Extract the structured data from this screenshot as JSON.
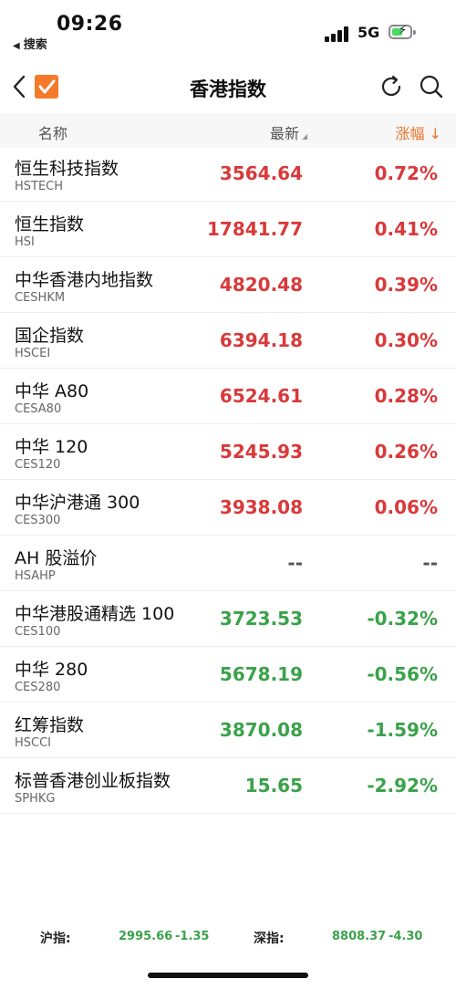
{
  "status_bar": {
    "time": "09:26",
    "back_app": "搜索",
    "network": "5G"
  },
  "nav": {
    "title": "香港指数"
  },
  "table_header": {
    "name": "名称",
    "latest": "最新",
    "change": "涨幅",
    "change_arrow": "↓"
  },
  "rows": [
    {
      "name": "恒生科技指数",
      "code": "HSTECH",
      "price": "3564.64",
      "change": "0.72%",
      "dir": "up"
    },
    {
      "name": "恒生指数",
      "code": "HSI",
      "price": "17841.77",
      "change": "0.41%",
      "dir": "up"
    },
    {
      "name": "中华香港内地指数",
      "code": "CESHKM",
      "price": "4820.48",
      "change": "0.39%",
      "dir": "up"
    },
    {
      "name": "国企指数",
      "code": "HSCEI",
      "price": "6394.18",
      "change": "0.30%",
      "dir": "up"
    },
    {
      "name": "中华 A80",
      "code": "CESA80",
      "price": "6524.61",
      "change": "0.28%",
      "dir": "up"
    },
    {
      "name": "中华 120",
      "code": "CES120",
      "price": "5245.93",
      "change": "0.26%",
      "dir": "up"
    },
    {
      "name": "中华沪港通 300",
      "code": "CES300",
      "price": "3938.08",
      "change": "0.06%",
      "dir": "up"
    },
    {
      "name": "AH 股溢价",
      "code": "HSAHP",
      "price": "--",
      "change": "--",
      "dir": "flat"
    },
    {
      "name": "中华港股通精选 100",
      "code": "CES100",
      "price": "3723.53",
      "change": "-0.32%",
      "dir": "down"
    },
    {
      "name": "中华 280",
      "code": "CES280",
      "price": "5678.19",
      "change": "-0.56%",
      "dir": "down"
    },
    {
      "name": "红筹指数",
      "code": "HSCCI",
      "price": "3870.08",
      "change": "-1.59%",
      "dir": "down"
    },
    {
      "name": "标普香港创业板指数",
      "code": "SPHKG",
      "price": "15.65",
      "change": "-2.92%",
      "dir": "down"
    }
  ],
  "footer": {
    "sh_label": "沪指:",
    "sh_value": "2995.66",
    "sh_change": "-1.35",
    "sz_label": "深指:",
    "sz_value": "8808.37",
    "sz_change": "-4.30"
  },
  "colors": {
    "up": "#d9393a",
    "down": "#3aa24a",
    "accent": "#f5792a"
  }
}
